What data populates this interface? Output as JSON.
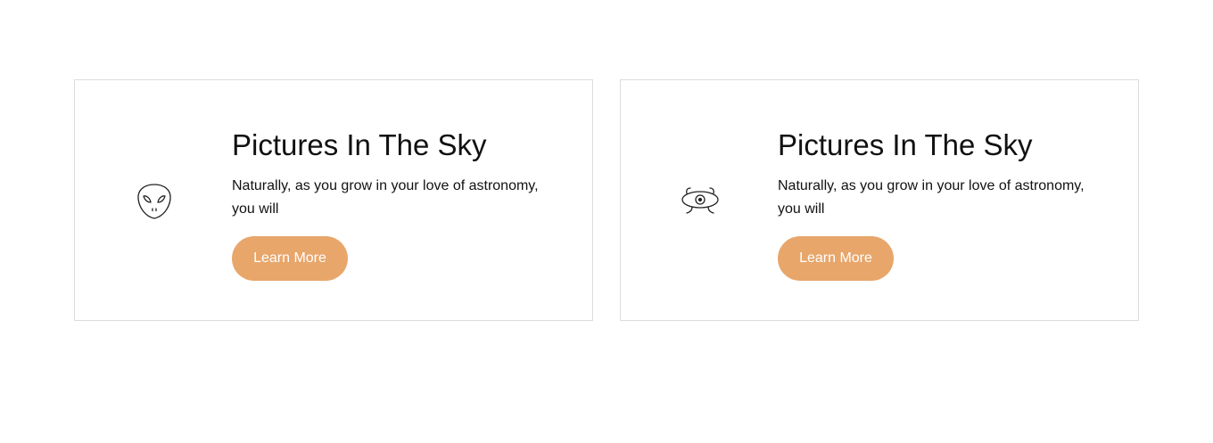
{
  "theme": {
    "accent": "#e8a66b",
    "border": "#dcdcdc"
  },
  "cards": [
    {
      "icon": "alien-head-icon",
      "title": "Pictures In The Sky",
      "text": "Naturally, as you grow in your love of astronomy, you will",
      "button_label": "Learn More"
    },
    {
      "icon": "one-eyed-alien-icon",
      "title": "Pictures In The Sky",
      "text": "Naturally, as you grow in your love of astronomy, you will",
      "button_label": "Learn More"
    }
  ]
}
